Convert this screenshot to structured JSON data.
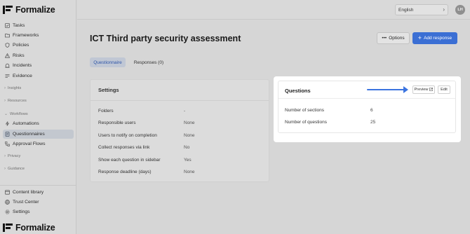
{
  "app": {
    "name": "Formalize"
  },
  "sidebar": {
    "top_items": [
      {
        "label": "Tasks",
        "icon": "checklist-icon"
      },
      {
        "label": "Frameworks",
        "icon": "folder-icon"
      },
      {
        "label": "Policies",
        "icon": "shield-icon"
      },
      {
        "label": "Risks",
        "icon": "warning-icon"
      },
      {
        "label": "Incidents",
        "icon": "siren-icon"
      },
      {
        "label": "Evidence",
        "icon": "list-icon"
      }
    ],
    "groups": {
      "insights": "Insights",
      "resources": "Resources",
      "workflows": "Workflows",
      "privacy": "Privacy",
      "guidance": "Guidance"
    },
    "workflow_items": [
      {
        "label": "Automations",
        "icon": "bolt-icon"
      },
      {
        "label": "Questionnaires",
        "icon": "document-icon",
        "active": true
      },
      {
        "label": "Approval Flows",
        "icon": "flow-icon"
      }
    ],
    "bottom_items": [
      {
        "label": "Content library",
        "icon": "library-icon"
      },
      {
        "label": "Trust Center",
        "icon": "globe-icon"
      },
      {
        "label": "Settings",
        "icon": "gear-icon"
      }
    ]
  },
  "topbar": {
    "language": "English",
    "avatar_initials": "LH"
  },
  "main": {
    "title": "ICT Third party security assessment",
    "options_label": "Options",
    "add_response_label": "Add response",
    "tabs": [
      {
        "label": "Questionnaire",
        "active": true
      },
      {
        "label": "Responses (0)",
        "active": false
      }
    ]
  },
  "settings_card": {
    "title": "Settings",
    "rows": [
      {
        "key": "Folders",
        "value": "-"
      },
      {
        "key": "Responsible users",
        "value": "None"
      },
      {
        "key": "Users to notify on completion",
        "value": "None"
      },
      {
        "key": "Collect responses via link",
        "value": "No"
      },
      {
        "key": "Show each question in sidebar",
        "value": "Yes"
      },
      {
        "key": "Response deadline (days)",
        "value": "None"
      }
    ]
  },
  "questions_card": {
    "title": "Questions",
    "preview_label": "Preview",
    "edit_label": "Edit",
    "rows": [
      {
        "key": "Number of sections",
        "value": "6"
      },
      {
        "key": "Number of questions",
        "value": "25"
      }
    ]
  },
  "colors": {
    "accent": "#3b6fd4",
    "arrow": "#3b74e0"
  }
}
